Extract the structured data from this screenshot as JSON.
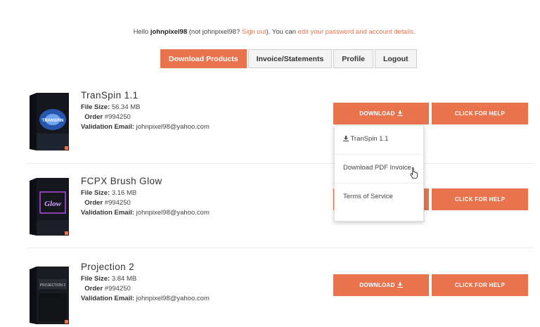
{
  "greeting": {
    "hello": "Hello ",
    "username": "johnpixel98",
    "not_prefix": " (not johnpixel98? ",
    "sign_out": "Sign out",
    "mid_text": "). You can ",
    "edit_link": "edit your password and account details",
    "end": "."
  },
  "tabs": [
    {
      "label": "Download Products",
      "active": true
    },
    {
      "label": "Invoice/Statements",
      "active": false
    },
    {
      "label": "Profile",
      "active": false
    },
    {
      "label": "Logout",
      "active": false
    }
  ],
  "labels": {
    "file_size": "File Size:",
    "order": "Order",
    "validation_email": "Validation Email:",
    "download_button": "DOWNLOAD",
    "help_button": "CLICK FOR HELP"
  },
  "products": [
    {
      "name": "TranSpin 1.1",
      "file_size": "56.34 MB",
      "order": "#994250",
      "email": "johnpixel98@yahoo.com",
      "box_text": "TRANSPIN"
    },
    {
      "name": "FCPX Brush Glow",
      "file_size": "3.16 MB",
      "order": "#994250",
      "email": "johnpixel98@yahoo.com",
      "box_text": "Glow"
    },
    {
      "name": "Projection 2",
      "file_size": "3.84 MB",
      "order": "#994250",
      "email": "johnpixel98@yahoo.com",
      "box_text": "PROJECTION 2"
    }
  ],
  "dropdown": {
    "items": [
      "TranSpin 1.1",
      "Download PDF Invoice",
      "Terms of Service"
    ]
  },
  "colors": {
    "accent": "#e8734d",
    "page_bg": "#ffffff",
    "box_dark": "#15171c"
  },
  "icons": {
    "download": "download-icon",
    "cursor": "hand-pointer-icon"
  }
}
